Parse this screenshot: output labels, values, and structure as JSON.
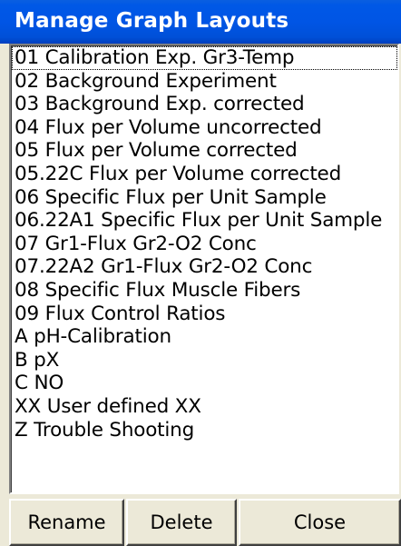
{
  "window": {
    "title": "Manage Graph Layouts"
  },
  "list": {
    "items": [
      "01 Calibration Exp. Gr3-Temp",
      "02 Background Experiment",
      "03 Background Exp. corrected",
      "04 Flux per Volume uncorrected",
      "05 Flux per Volume corrected",
      "05.22C Flux per Volume corrected",
      "06 Specific Flux per Unit Sample",
      "06.22A1 Specific Flux per Unit Sample",
      "07 Gr1-Flux Gr2-O2 Conc",
      "07.22A2 Gr1-Flux Gr2-O2 Conc",
      "08 Specific Flux Muscle Fibers",
      "09 Flux Control Ratios",
      "A pH-Calibration",
      "B pX",
      "C NO",
      "XX  User defined XX",
      "Z Trouble Shooting"
    ],
    "focused_index": 0
  },
  "buttons": {
    "rename_label": "Rename",
    "delete_label": "Delete",
    "close_label": "Close"
  },
  "colors": {
    "titlebar": "#0055e5",
    "title_text": "#ffffff",
    "dialog_background": "#ece9d8",
    "list_background": "#ffffff"
  }
}
